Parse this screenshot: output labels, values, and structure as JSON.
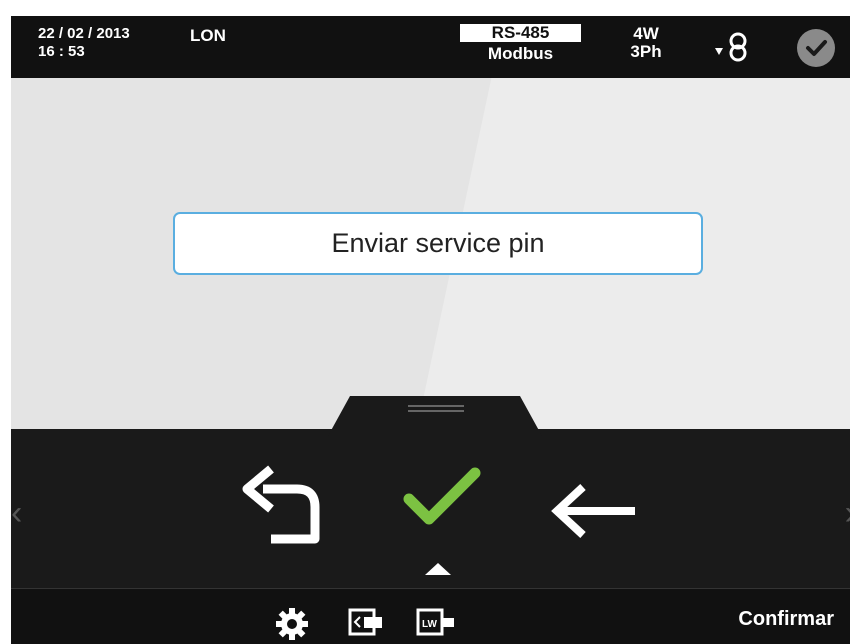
{
  "status_bar": {
    "date": "22 / 02 / 2013",
    "time": "16 : 53",
    "protocol": "LON",
    "comm_bus": "RS-485",
    "comm_protocol": "Modbus",
    "wiring_wires": "4W",
    "wiring_phases": "3Ph",
    "ct_icon": "current-transformer-icon",
    "status_icon": "check-circle-icon"
  },
  "main": {
    "action_label": "Enviar service pin"
  },
  "controls": {
    "back_icon": "return-icon",
    "confirm_icon": "checkmark-icon",
    "delete_icon": "left-arrow-icon",
    "prev_label": "‹",
    "next_label": "›"
  },
  "bottom_bar": {
    "settings_icon": "gear-icon",
    "screen_icon": "screen-switch-icon",
    "lw_icon": "lw-icon",
    "confirm_label": "Confirmar"
  },
  "colors": {
    "accent_check": "#7cc242",
    "button_border": "#5aaee0",
    "bar_background": "#1a1a1a"
  }
}
